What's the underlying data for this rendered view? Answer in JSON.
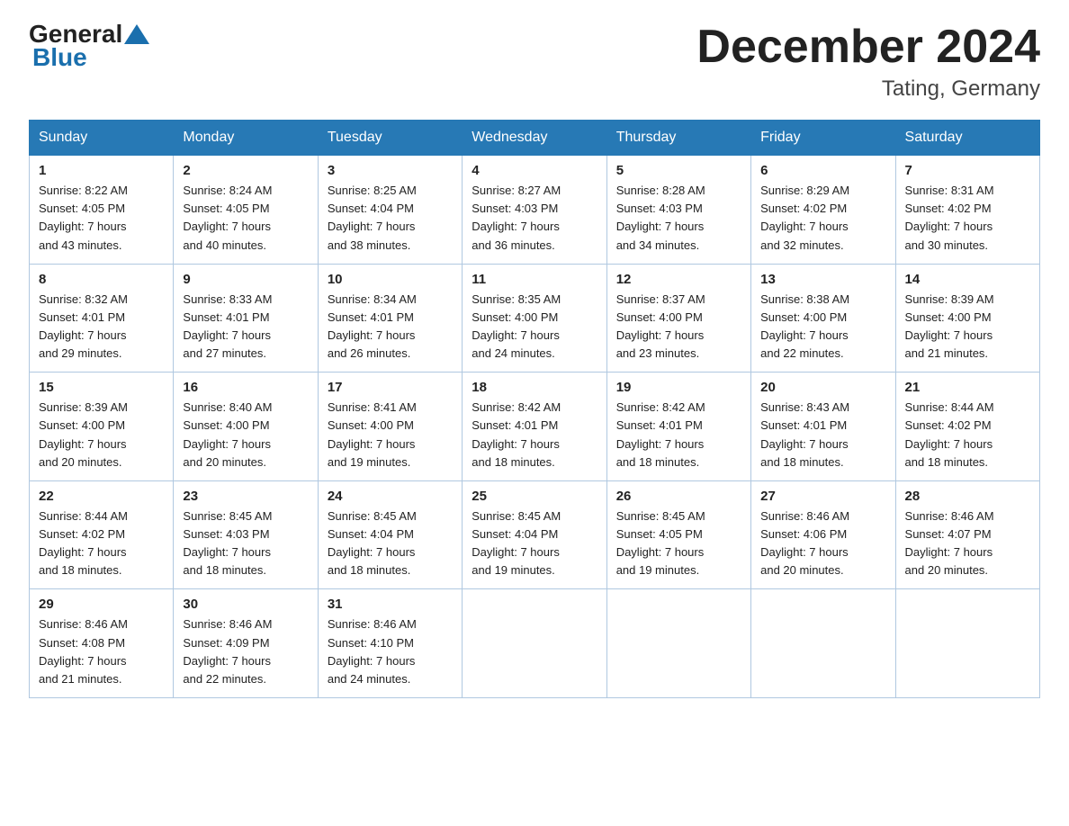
{
  "header": {
    "logo_general": "General",
    "logo_blue": "Blue",
    "month_title": "December 2024",
    "location": "Tating, Germany"
  },
  "days_of_week": [
    "Sunday",
    "Monday",
    "Tuesday",
    "Wednesday",
    "Thursday",
    "Friday",
    "Saturday"
  ],
  "weeks": [
    [
      {
        "day": "1",
        "sunrise": "8:22 AM",
        "sunset": "4:05 PM",
        "daylight": "7 hours and 43 minutes."
      },
      {
        "day": "2",
        "sunrise": "8:24 AM",
        "sunset": "4:05 PM",
        "daylight": "7 hours and 40 minutes."
      },
      {
        "day": "3",
        "sunrise": "8:25 AM",
        "sunset": "4:04 PM",
        "daylight": "7 hours and 38 minutes."
      },
      {
        "day": "4",
        "sunrise": "8:27 AM",
        "sunset": "4:03 PM",
        "daylight": "7 hours and 36 minutes."
      },
      {
        "day": "5",
        "sunrise": "8:28 AM",
        "sunset": "4:03 PM",
        "daylight": "7 hours and 34 minutes."
      },
      {
        "day": "6",
        "sunrise": "8:29 AM",
        "sunset": "4:02 PM",
        "daylight": "7 hours and 32 minutes."
      },
      {
        "day": "7",
        "sunrise": "8:31 AM",
        "sunset": "4:02 PM",
        "daylight": "7 hours and 30 minutes."
      }
    ],
    [
      {
        "day": "8",
        "sunrise": "8:32 AM",
        "sunset": "4:01 PM",
        "daylight": "7 hours and 29 minutes."
      },
      {
        "day": "9",
        "sunrise": "8:33 AM",
        "sunset": "4:01 PM",
        "daylight": "7 hours and 27 minutes."
      },
      {
        "day": "10",
        "sunrise": "8:34 AM",
        "sunset": "4:01 PM",
        "daylight": "7 hours and 26 minutes."
      },
      {
        "day": "11",
        "sunrise": "8:35 AM",
        "sunset": "4:00 PM",
        "daylight": "7 hours and 24 minutes."
      },
      {
        "day": "12",
        "sunrise": "8:37 AM",
        "sunset": "4:00 PM",
        "daylight": "7 hours and 23 minutes."
      },
      {
        "day": "13",
        "sunrise": "8:38 AM",
        "sunset": "4:00 PM",
        "daylight": "7 hours and 22 minutes."
      },
      {
        "day": "14",
        "sunrise": "8:39 AM",
        "sunset": "4:00 PM",
        "daylight": "7 hours and 21 minutes."
      }
    ],
    [
      {
        "day": "15",
        "sunrise": "8:39 AM",
        "sunset": "4:00 PM",
        "daylight": "7 hours and 20 minutes."
      },
      {
        "day": "16",
        "sunrise": "8:40 AM",
        "sunset": "4:00 PM",
        "daylight": "7 hours and 20 minutes."
      },
      {
        "day": "17",
        "sunrise": "8:41 AM",
        "sunset": "4:00 PM",
        "daylight": "7 hours and 19 minutes."
      },
      {
        "day": "18",
        "sunrise": "8:42 AM",
        "sunset": "4:01 PM",
        "daylight": "7 hours and 18 minutes."
      },
      {
        "day": "19",
        "sunrise": "8:42 AM",
        "sunset": "4:01 PM",
        "daylight": "7 hours and 18 minutes."
      },
      {
        "day": "20",
        "sunrise": "8:43 AM",
        "sunset": "4:01 PM",
        "daylight": "7 hours and 18 minutes."
      },
      {
        "day": "21",
        "sunrise": "8:44 AM",
        "sunset": "4:02 PM",
        "daylight": "7 hours and 18 minutes."
      }
    ],
    [
      {
        "day": "22",
        "sunrise": "8:44 AM",
        "sunset": "4:02 PM",
        "daylight": "7 hours and 18 minutes."
      },
      {
        "day": "23",
        "sunrise": "8:45 AM",
        "sunset": "4:03 PM",
        "daylight": "7 hours and 18 minutes."
      },
      {
        "day": "24",
        "sunrise": "8:45 AM",
        "sunset": "4:04 PM",
        "daylight": "7 hours and 18 minutes."
      },
      {
        "day": "25",
        "sunrise": "8:45 AM",
        "sunset": "4:04 PM",
        "daylight": "7 hours and 19 minutes."
      },
      {
        "day": "26",
        "sunrise": "8:45 AM",
        "sunset": "4:05 PM",
        "daylight": "7 hours and 19 minutes."
      },
      {
        "day": "27",
        "sunrise": "8:46 AM",
        "sunset": "4:06 PM",
        "daylight": "7 hours and 20 minutes."
      },
      {
        "day": "28",
        "sunrise": "8:46 AM",
        "sunset": "4:07 PM",
        "daylight": "7 hours and 20 minutes."
      }
    ],
    [
      {
        "day": "29",
        "sunrise": "8:46 AM",
        "sunset": "4:08 PM",
        "daylight": "7 hours and 21 minutes."
      },
      {
        "day": "30",
        "sunrise": "8:46 AM",
        "sunset": "4:09 PM",
        "daylight": "7 hours and 22 minutes."
      },
      {
        "day": "31",
        "sunrise": "8:46 AM",
        "sunset": "4:10 PM",
        "daylight": "7 hours and 24 minutes."
      },
      null,
      null,
      null,
      null
    ]
  ],
  "labels": {
    "sunrise": "Sunrise:",
    "sunset": "Sunset:",
    "daylight": "Daylight:"
  }
}
